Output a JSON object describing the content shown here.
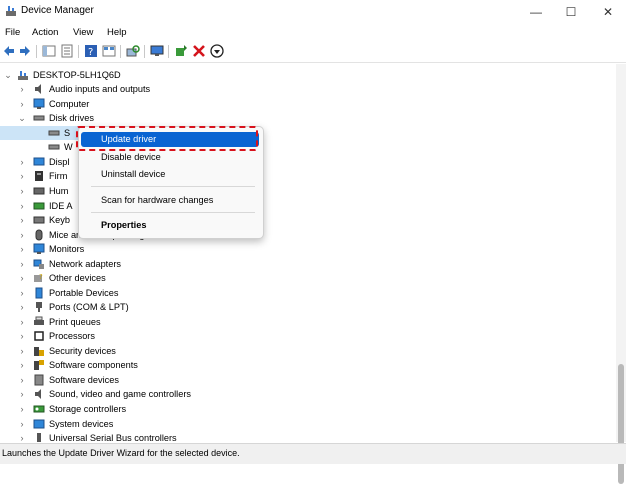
{
  "window": {
    "title": "Device Manager",
    "controls": [
      "—",
      "☐",
      "✕"
    ]
  },
  "menu": [
    "File",
    "Action",
    "View",
    "Help"
  ],
  "tree": {
    "root": "DESKTOP-5LH1Q6D",
    "items": [
      {
        "label": "Audio inputs and outputs",
        "icon": "speaker-icon",
        "expanded": false
      },
      {
        "label": "Computer",
        "icon": "monitor-icon",
        "expanded": false
      },
      {
        "label": "Disk drives",
        "icon": "disk-drive-icon",
        "expanded": true
      },
      {
        "label": "S",
        "icon": "disk-drive-icon",
        "child": true
      },
      {
        "label": "W",
        "icon": "disk-drive-icon",
        "child": true
      },
      {
        "label": "Displ",
        "icon": "display-adapter-icon",
        "expanded": false
      },
      {
        "label": "Firm",
        "icon": "firmware-icon",
        "expanded": false
      },
      {
        "label": "Hum",
        "icon": "keyboard-icon",
        "expanded": false
      },
      {
        "label": "IDE A",
        "icon": "ide-controller-icon",
        "expanded": false
      },
      {
        "label": "Keyb",
        "icon": "keyboard-icon",
        "expanded": false
      },
      {
        "label": "Mice and other pointing devices",
        "icon": "mouse-icon",
        "expanded": false
      },
      {
        "label": "Monitors",
        "icon": "monitor-icon",
        "expanded": false
      },
      {
        "label": "Network adapters",
        "icon": "network-adapter-icon",
        "expanded": false
      },
      {
        "label": "Other devices",
        "icon": "question-device-icon",
        "expanded": false
      },
      {
        "label": "Portable Devices",
        "icon": "portable-device-icon",
        "expanded": false
      },
      {
        "label": "Ports (COM & LPT)",
        "icon": "port-icon",
        "expanded": false
      },
      {
        "label": "Print queues",
        "icon": "printer-icon",
        "expanded": false
      },
      {
        "label": "Processors",
        "icon": "processor-icon",
        "expanded": false
      },
      {
        "label": "Security devices",
        "icon": "security-device-icon",
        "expanded": false
      },
      {
        "label": "Software components",
        "icon": "software-component-icon",
        "expanded": false
      },
      {
        "label": "Software devices",
        "icon": "software-device-icon",
        "expanded": false
      },
      {
        "label": "Sound, video and game controllers",
        "icon": "speaker-icon",
        "expanded": false
      },
      {
        "label": "Storage controllers",
        "icon": "storage-controller-icon",
        "expanded": false
      },
      {
        "label": "System devices",
        "icon": "system-device-icon",
        "expanded": false
      },
      {
        "label": "Universal Serial Bus controllers",
        "icon": "usb-icon",
        "expanded": false
      }
    ]
  },
  "context_menu": {
    "items": [
      "Update driver",
      "Disable device",
      "Uninstall device",
      "Scan for hardware changes",
      "Properties"
    ],
    "highlighted": "Update driver"
  },
  "status_bar": "Launches the Update Driver Wizard for the selected device.",
  "colors": {
    "highlight": "#0a64d2",
    "annotation": "#d8121c"
  }
}
